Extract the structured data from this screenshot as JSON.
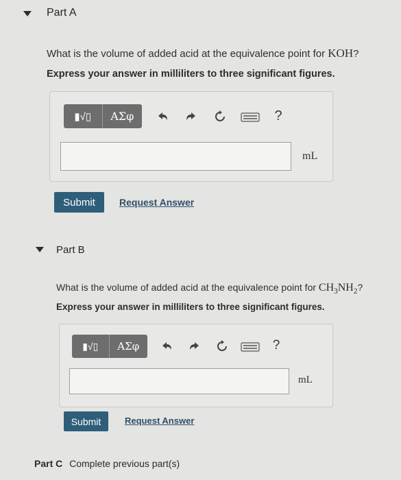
{
  "partA": {
    "title": "Part A",
    "question_prefix": "What is the volume of added acid at the equivalence point for ",
    "question_formula": "KOH",
    "question_suffix": "?",
    "instruction": "Express your answer in milliliters to three significant figures.",
    "toolbar": {
      "templates_label": "▮√▯",
      "symbols_label": "ΑΣφ",
      "help_label": "?"
    },
    "unit": "mL",
    "submit_label": "Submit",
    "request_label": "Request Answer",
    "answer_value": ""
  },
  "partB": {
    "title": "Part B",
    "question_prefix": "What is the volume of added acid at the equivalence point for ",
    "question_formula_parts": [
      "CH",
      "3",
      "NH",
      "2"
    ],
    "question_suffix": "?",
    "instruction": "Express your answer in milliliters to three significant figures.",
    "toolbar": {
      "templates_label": "▮√▯",
      "symbols_label": "ΑΣφ",
      "help_label": "?"
    },
    "unit": "mL",
    "submit_label": "Submit",
    "request_label": "Request Answer",
    "answer_value": ""
  },
  "partC": {
    "title": "Part C",
    "status": "Complete previous part(s)"
  }
}
